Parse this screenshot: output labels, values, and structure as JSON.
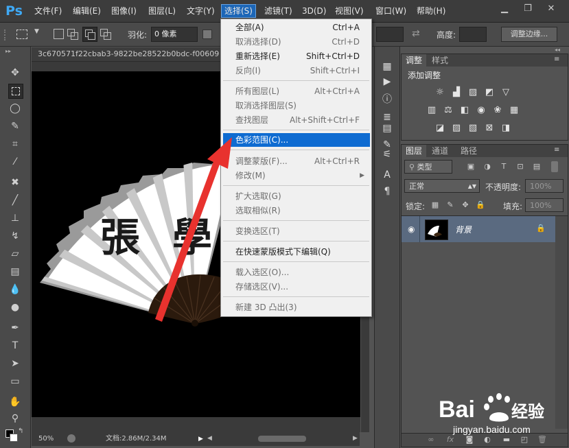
{
  "app": {
    "logo": "Ps"
  },
  "menubar": {
    "items": [
      "文件(F)",
      "编辑(E)",
      "图像(I)",
      "图层(L)",
      "文字(Y)",
      "选择(S)",
      "滤镜(T)",
      "3D(D)",
      "视图(V)",
      "窗口(W)",
      "帮助(H)"
    ],
    "active_index": 5,
    "window_controls": [
      "▁",
      "❐",
      "✕"
    ]
  },
  "options": {
    "feather_label": "羽化:",
    "feather_value": "0 像素",
    "height_label": "高度:",
    "refine_edge_button": "调整边缘..."
  },
  "document": {
    "tab_title": "3c670571f22cbab3-9822be28522b0bdc-f00609",
    "zoom": "50%",
    "doc_info": "文档:2.86M/2.34M",
    "fan_text_chars": [
      "張",
      "學"
    ]
  },
  "select_menu": {
    "items": [
      {
        "label": "全部(A)",
        "shortcut": "Ctrl+A",
        "disabled": false
      },
      {
        "label": "取消选择(D)",
        "shortcut": "Ctrl+D",
        "disabled": true
      },
      {
        "label": "重新选择(E)",
        "shortcut": "Shift+Ctrl+D",
        "disabled": false
      },
      {
        "label": "反向(I)",
        "shortcut": "Shift+Ctrl+I",
        "disabled": true
      },
      {
        "label": "所有图层(L)",
        "shortcut": "Alt+Ctrl+A",
        "disabled": true
      },
      {
        "label": "取消选择图层(S)",
        "shortcut": "",
        "disabled": true
      },
      {
        "label": "查找图层",
        "shortcut": "Alt+Shift+Ctrl+F",
        "disabled": true
      },
      {
        "label": "色彩范围(C)...",
        "shortcut": "",
        "disabled": false,
        "highlighted": true
      },
      {
        "label": "调整蒙版(F)...",
        "shortcut": "Alt+Ctrl+R",
        "disabled": true
      },
      {
        "label": "修改(M)",
        "shortcut": "",
        "disabled": true,
        "submenu": true
      },
      {
        "label": "扩大选取(G)",
        "shortcut": "",
        "disabled": true
      },
      {
        "label": "选取相似(R)",
        "shortcut": "",
        "disabled": true
      },
      {
        "label": "变换选区(T)",
        "shortcut": "",
        "disabled": true
      },
      {
        "label": "在快速蒙版模式下编辑(Q)",
        "shortcut": "",
        "disabled": false
      },
      {
        "label": "载入选区(O)...",
        "shortcut": "",
        "disabled": true
      },
      {
        "label": "存储选区(V)...",
        "shortcut": "",
        "disabled": true
      },
      {
        "label": "新建 3D 凸出(3)",
        "shortcut": "",
        "disabled": true
      }
    ]
  },
  "adjustments_panel": {
    "tabs": [
      "调整",
      "样式"
    ],
    "title": "添加调整"
  },
  "layers_panel": {
    "tabs": [
      "图层",
      "通道",
      "路径"
    ],
    "filter_label": "类型",
    "blend_mode": "正常",
    "opacity_label": "不透明度:",
    "opacity_value": "100%",
    "lock_label": "锁定:",
    "fill_label": "填充:",
    "fill_value": "100%",
    "layer_name": "背景"
  },
  "watermark": {
    "logo_text": "Bai du 经验",
    "url": "jingyan.baidu.com"
  },
  "colors": {
    "menu_highlight": "#0e6bd1",
    "arrow": "#e8322e",
    "layer_selected": "#5a6a80",
    "ps_blue": "#3fa9f5"
  }
}
